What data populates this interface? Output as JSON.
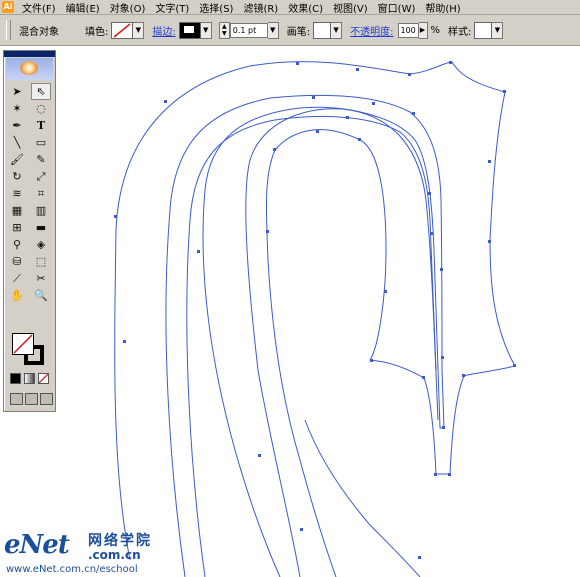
{
  "menubar": {
    "app_icon": "illustrator-icon",
    "items": [
      "文件(F)",
      "编辑(E)",
      "对象(O)",
      "文字(T)",
      "选择(S)",
      "滤镜(R)",
      "效果(C)",
      "视图(V)",
      "窗口(W)",
      "帮助(H)"
    ]
  },
  "controlbar": {
    "object_type": "混合对象",
    "fill_label": "填色:",
    "stroke_label": "描边:",
    "stroke_weight": "0.1 pt",
    "brush_label": "画笔:",
    "opacity_label": "不透明度:",
    "opacity_value": "100",
    "opacity_unit": "%",
    "style_label": "样式:"
  },
  "toolbox": {
    "tools": [
      "selection-tool-icon",
      "direct-selection-tool-icon",
      "magic-wand-icon",
      "lasso-icon",
      "pen-icon",
      "type-icon",
      "line-icon",
      "rectangle-icon",
      "paintbrush-icon",
      "pencil-icon",
      "rotate-icon",
      "scale-icon",
      "warp-icon",
      "free-transform-icon",
      "symbol-sprayer-icon",
      "graph-icon",
      "mesh-icon",
      "gradient-icon",
      "eyedropper-icon",
      "blend-icon",
      "live-paint-icon",
      "live-paint-selection-icon",
      "slice-icon",
      "scissors-icon",
      "hand-icon",
      "zoom-icon"
    ]
  },
  "watermark": {
    "logo": "eNet",
    "chinese": "网络学院",
    "domain": ".com.cn",
    "url": "www.eNet.com.cn/eschool"
  },
  "colors": {
    "path_stroke": "#3b5bc9",
    "anchor": "#3b5bc9",
    "ui_gray": "#d4d0c8",
    "link_blue": "#1f3bd6"
  }
}
